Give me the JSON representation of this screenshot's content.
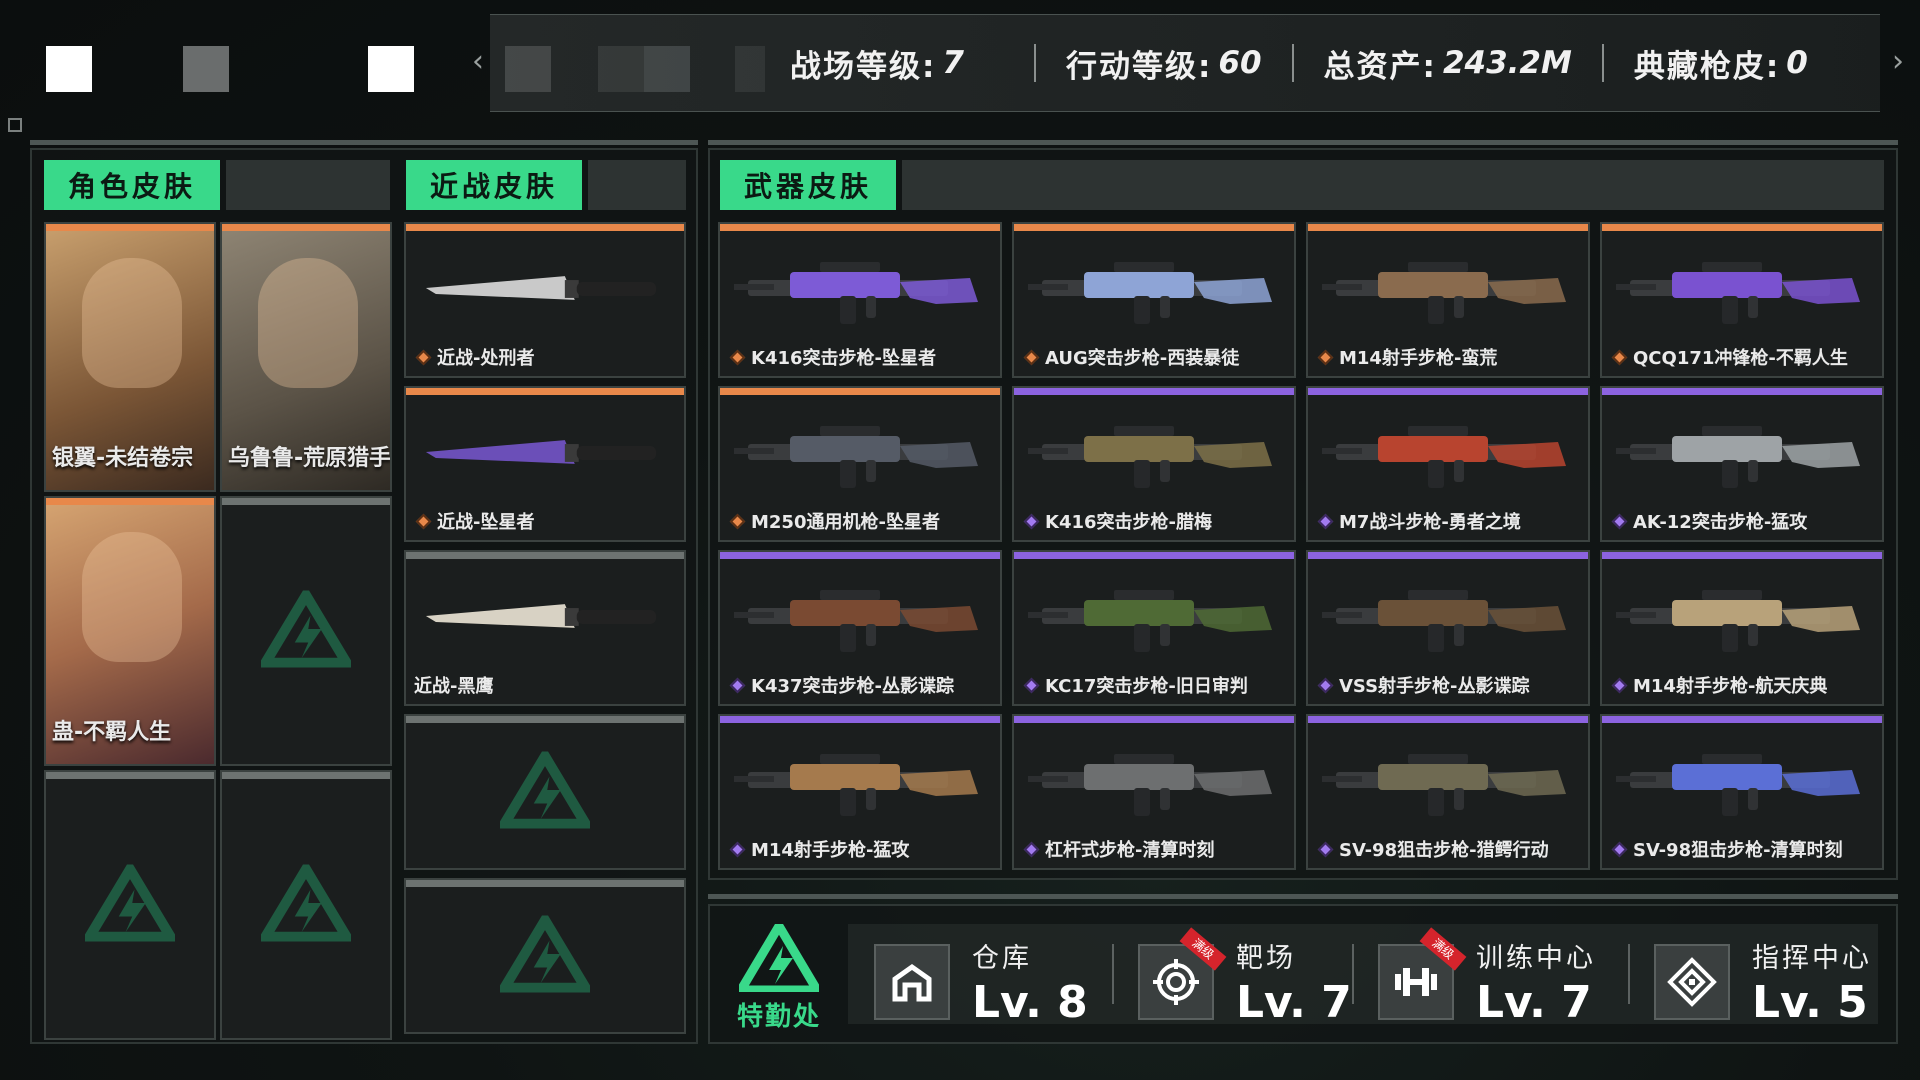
{
  "top_stats": [
    {
      "label": "战场等级:",
      "value": "7"
    },
    {
      "label": "行动等级:",
      "value": "60"
    },
    {
      "label": "总资产:",
      "value": "243.2M"
    },
    {
      "label": "典藏枪皮:",
      "value": "0"
    }
  ],
  "sections": {
    "character": "角色皮肤",
    "melee": "近战皮肤",
    "weapon": "武器皮肤"
  },
  "character_skins": [
    {
      "name": "银翼-未结卷宗",
      "rarity": "orange"
    },
    {
      "name": "乌鲁鲁-荒原猎手",
      "rarity": "orange"
    },
    {
      "name": "蛊-不羁人生",
      "rarity": "orange"
    }
  ],
  "melee_skins": [
    {
      "name": "近战-处刑者",
      "rarity": "orange"
    },
    {
      "name": "近战-坠星者",
      "rarity": "orange"
    },
    {
      "name": "近战-黑鹰",
      "rarity": "grey"
    }
  ],
  "weapon_skins": [
    {
      "name": "K416突击步枪-坠星者",
      "rarity": "orange"
    },
    {
      "name": "AUG突击步枪-西装暴徒",
      "rarity": "orange"
    },
    {
      "name": "M14射手步枪-蛮荒",
      "rarity": "orange"
    },
    {
      "name": "QCQ171冲锋枪-不羁人生",
      "rarity": "orange"
    },
    {
      "name": "M250通用机枪-坠星者",
      "rarity": "orange"
    },
    {
      "name": "K416突击步枪-腊梅",
      "rarity": "purple"
    },
    {
      "name": "M7战斗步枪-勇者之境",
      "rarity": "purple"
    },
    {
      "name": "AK-12突击步枪-猛攻",
      "rarity": "purple"
    },
    {
      "name": "K437突击步枪-丛影谍踪",
      "rarity": "purple"
    },
    {
      "name": "KC17突击步枪-旧日审判",
      "rarity": "purple"
    },
    {
      "name": "VSS射手步枪-丛影谍踪",
      "rarity": "purple"
    },
    {
      "name": "M14射手步枪-航天庆典",
      "rarity": "purple"
    },
    {
      "name": "M14射手步枪-猛攻",
      "rarity": "purple"
    },
    {
      "name": "杠杆式步枪-清算时刻",
      "rarity": "purple"
    },
    {
      "name": "SV-98狙击步枪-猎鳄行动",
      "rarity": "purple"
    },
    {
      "name": "SV-98狙击步枪-清算时刻",
      "rarity": "purple"
    }
  ],
  "special_dept": {
    "label": "特勤处"
  },
  "facilities": [
    {
      "name": "仓库",
      "level": "Lv. 8",
      "maxed": false,
      "icon": "warehouse-icon"
    },
    {
      "name": "靶场",
      "level": "Lv. 7",
      "maxed": true,
      "maxed_label": "满级",
      "icon": "target-icon"
    },
    {
      "name": "训练中心",
      "level": "Lv. 7",
      "maxed": true,
      "maxed_label": "满级",
      "icon": "dumbbell-icon"
    },
    {
      "name": "指挥中心",
      "level": "Lv. 5",
      "maxed": false,
      "icon": "command-icon"
    }
  ],
  "colors": {
    "accent": "#39d98a",
    "orange": "#e8884a",
    "purple": "#8c63e0",
    "grey": "#6d7371"
  }
}
